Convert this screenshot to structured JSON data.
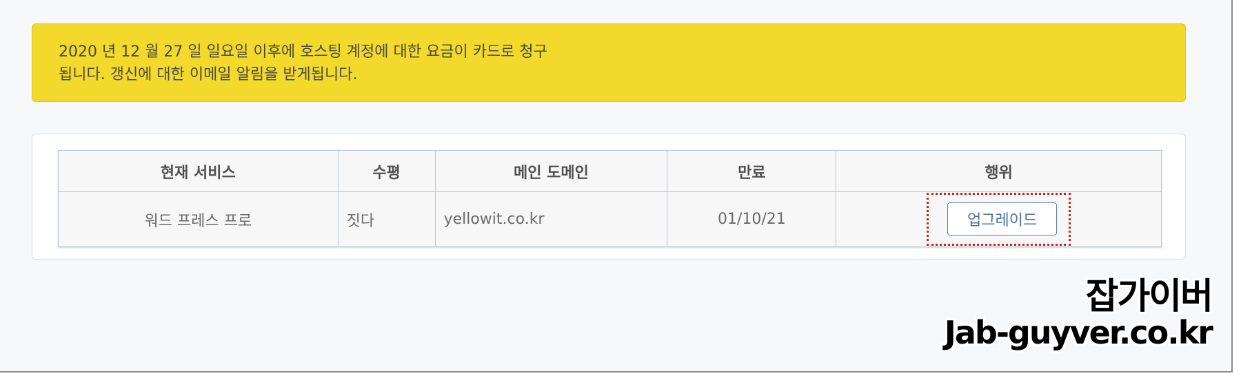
{
  "notice": {
    "line1": "2020 년 12 월 27 일 일요일 이후에 호스팅 계정에 대한 요금이 카드로 청구",
    "line2": "됩니다. 갱신에 대한 이메일 알림을 받게됩니다."
  },
  "table": {
    "headers": {
      "service": "현재 서비스",
      "level": "수평",
      "domain": "메인 도메인",
      "expires": "만료",
      "action": "행위"
    },
    "rows": [
      {
        "service": "워드 프레스 프로",
        "level": "짓다",
        "domain": "yellowit.co.kr",
        "expires": "01/10/21",
        "action_label": "업그레이드"
      }
    ]
  },
  "watermark": {
    "korean": "잡가이버",
    "site": "Jab-guyver.co.kr"
  },
  "colors": {
    "notice_bg": "#f2d92b",
    "highlight_border": "#cc1f1f",
    "expires_text": "#7e94ad",
    "button_border": "#5b7ea8"
  }
}
